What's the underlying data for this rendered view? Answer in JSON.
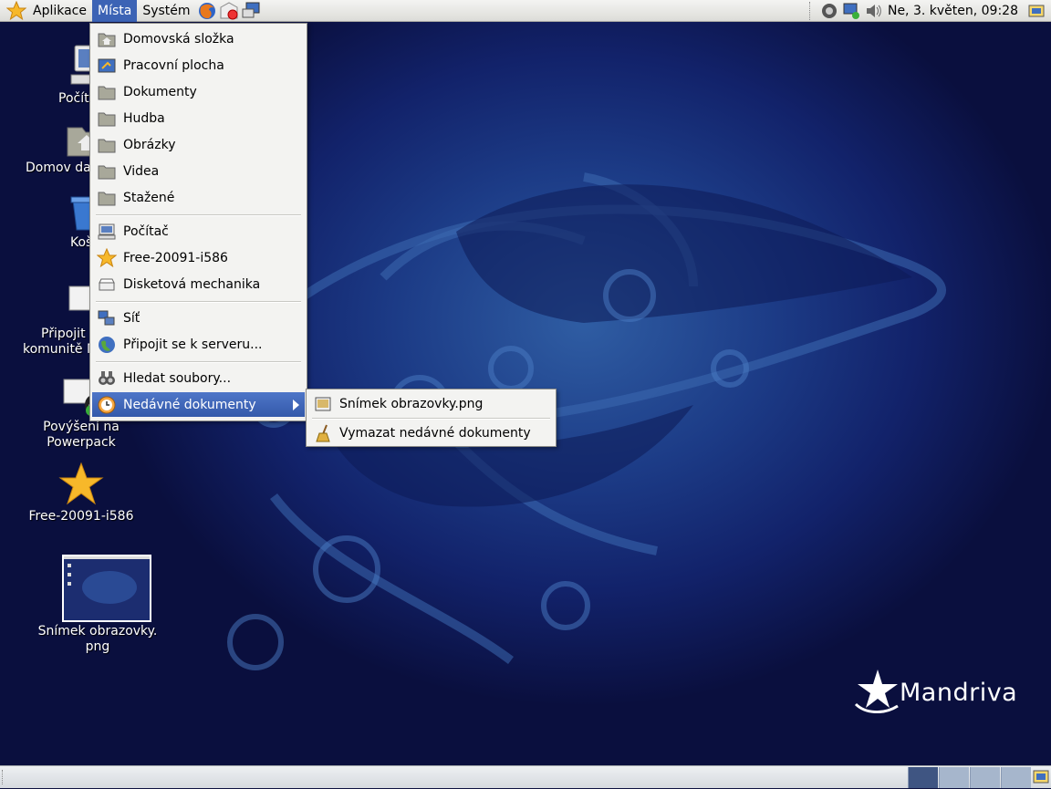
{
  "top_panel": {
    "menus": [
      "Aplikace",
      "Místa",
      "Systém"
    ],
    "clock": "Ne,  3. květen, 09:28"
  },
  "places_menu": {
    "items": [
      {
        "label": "Domovská složka",
        "icon": "home-folder-icon"
      },
      {
        "label": "Pracovní plocha",
        "icon": "desktop-icon"
      },
      {
        "label": "Dokumenty",
        "icon": "folder-icon"
      },
      {
        "label": "Hudba",
        "icon": "folder-icon"
      },
      {
        "label": "Obrázky",
        "icon": "folder-icon"
      },
      {
        "label": "Videa",
        "icon": "folder-icon"
      },
      {
        "label": "Stažené",
        "icon": "folder-icon"
      },
      {
        "label": "Počítač",
        "icon": "computer-icon"
      },
      {
        "label": "Free-20091-i586",
        "icon": "star-icon"
      },
      {
        "label": "Disketová mechanika",
        "icon": "floppy-drive-icon"
      },
      {
        "label": "Síť",
        "icon": "network-icon"
      },
      {
        "label": "Připojit se k serveru...",
        "icon": "globe-icon"
      },
      {
        "label": "Hledat soubory...",
        "icon": "search-icon"
      },
      {
        "label": "Nedávné dokumenty",
        "icon": "clock-icon"
      }
    ]
  },
  "recent_submenu": {
    "items": [
      {
        "label": "Snímek obrazovky.png",
        "icon": "image-file-icon"
      },
      {
        "label": "Vymazat nedávné dokumenty",
        "icon": "broom-icon"
      }
    ]
  },
  "desktop_icons": {
    "computer": "Počít",
    "home": "Domov dav",
    "trash": "Koš",
    "community_1": "Připojit s",
    "community_2": "komunitě M",
    "powerpack_1": "Povýšení na",
    "powerpack_2": "Powerpack",
    "free": "Free-20091-i586",
    "screenshot_1": "Snímek obrazovky.",
    "screenshot_2": "png"
  },
  "branding": {
    "logo_text": "Mandriva"
  },
  "colors": {
    "menu_highlight": "#3c63b5",
    "desktop_dark": "#0d1240",
    "desktop_light": "#2f5da3"
  }
}
